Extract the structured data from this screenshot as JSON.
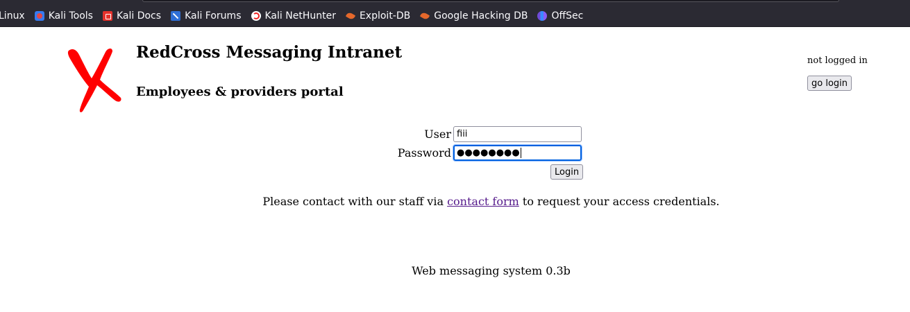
{
  "browser": {
    "bookmarks": [
      {
        "label": "Linux",
        "icon": "none"
      },
      {
        "label": "Kali Tools",
        "icon": "kali-icon"
      },
      {
        "label": "Kali Docs",
        "icon": "kali-docs-icon"
      },
      {
        "label": "Kali Forums",
        "icon": "kali-forums-icon"
      },
      {
        "label": "Kali NetHunter",
        "icon": "nethunter-icon"
      },
      {
        "label": "Exploit-DB",
        "icon": "exploit-db-icon"
      },
      {
        "label": "Google Hacking DB",
        "icon": "exploit-db-icon"
      },
      {
        "label": "OffSec",
        "icon": "offsec-icon"
      }
    ]
  },
  "header": {
    "title": "RedCross Messaging Intranet",
    "subtitle": "Employees & providers portal",
    "logo_color": "#ff0000"
  },
  "session": {
    "status": "not logged in",
    "go_login_label": "go login"
  },
  "login_form": {
    "user_label": "User",
    "user_value": "fiii",
    "password_label": "Password",
    "password_masked": "●●●●●●●●",
    "submit_label": "Login"
  },
  "info": {
    "prefix": "Please contact with our staff via ",
    "link_text": "contact form",
    "suffix": " to request your access credentials."
  },
  "footer": {
    "text": "Web messaging system 0.3b"
  }
}
